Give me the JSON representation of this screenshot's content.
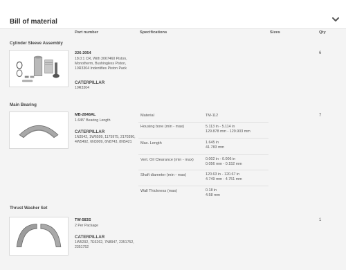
{
  "header": {
    "title": "Bill of material",
    "toggle_icon": "chevron-down-icon"
  },
  "columns": {
    "part_number": "Part number",
    "specifications": "Specifications",
    "sizes": "Sizes",
    "qty": "Qty"
  },
  "sections": [
    {
      "title": "Cylinder Sleeve Assembly",
      "part_number": "226-2054",
      "description": "18.0:1 CR, With 3067460 Piston, Monotherm, Bushingless Piston, 10R3304 Indentifies Piston Pack",
      "brand": "CATERPILLAR",
      "numbers": "10R3304",
      "qty": "6",
      "image_icon": "cylinder-sleeve-kit-icon"
    },
    {
      "title": "Main Bearing",
      "part_number": "MB-2848AL",
      "description": "1.645\" Bearing Length",
      "brand": "CATERPILLAR",
      "numbers": "1N3542, 1W6599, 1175975, 2170390, 4W5492, 6N3909, 6N8743, 8N5421",
      "qty": "7",
      "image_icon": "bearing-shell-icon",
      "specs": [
        {
          "name": "Material",
          "value": "TM-112"
        },
        {
          "name": "Housing bore (min - max)",
          "value": "5.113 in - 5.114 in\n129.878 mm - 129.903 mm"
        },
        {
          "name": "Max. Length",
          "value": "1.645 in\n41.783 mm"
        },
        {
          "name": "Vert. Oil Clearance (min - max)",
          "value": "0.002 in - 0.006 in\n0.056 mm - 0.152 mm"
        },
        {
          "name": "Shaft diameter (min - max)",
          "value": "120.63 in - 120.67 in\n4.749 mm - 4.751 mm"
        },
        {
          "name": "Wall Thickness (max)",
          "value": "0.18 in\n4.58 mm"
        }
      ]
    },
    {
      "title": "Thrust Washer Set",
      "part_number": "TW-583S",
      "description": "2 Per Package",
      "brand": "CATERPILLAR",
      "numbers": "1W5292, 7E6262, 7N8947, 2351752, 2351752",
      "qty": "1",
      "image_icon": "thrust-washer-icon"
    }
  ],
  "colors": {
    "panel_bg": "#f4f4f4",
    "header_bg": "#ffffff",
    "text": "#333333",
    "border": "#d9d9d9"
  }
}
